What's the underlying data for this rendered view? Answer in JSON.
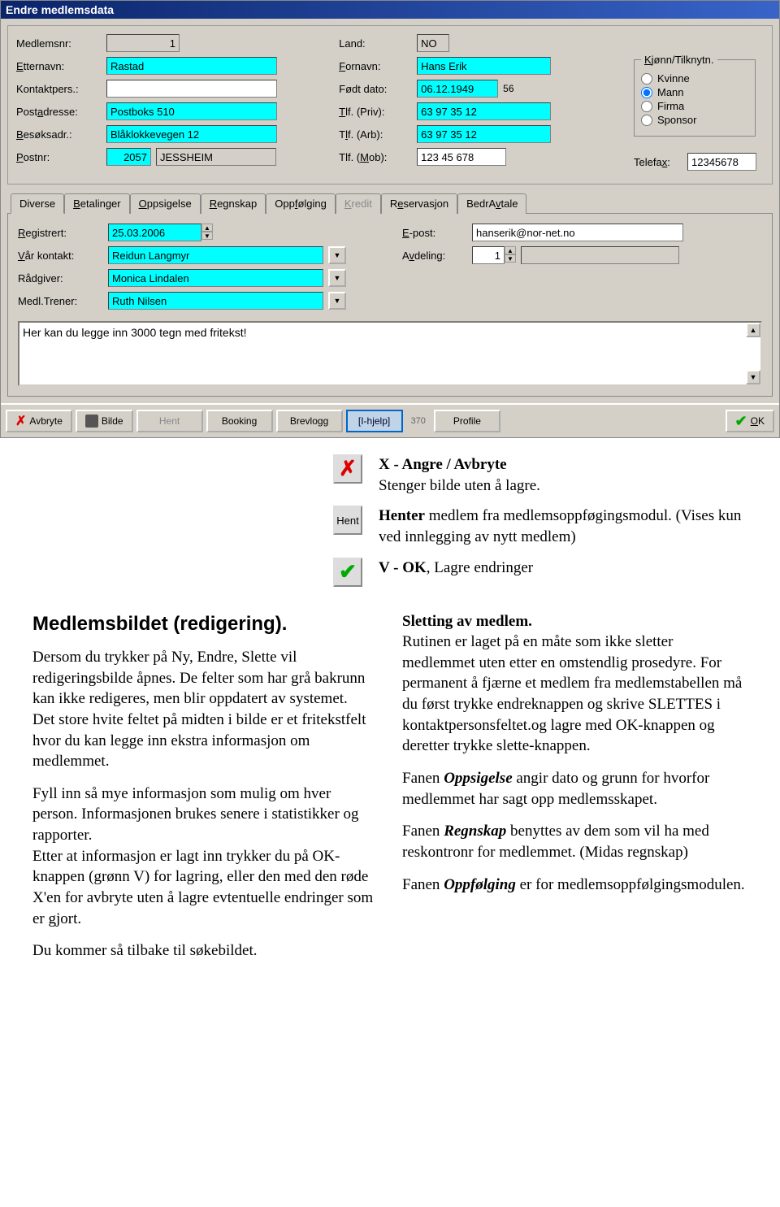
{
  "window": {
    "title": "Endre medlemsdata"
  },
  "labels": {
    "medlemsnr": "Medlemsnr:",
    "etternavn": "Etternavn:",
    "kontaktpers": "Kontaktpers.:",
    "postadresse": "Postadresse:",
    "besoksadr": "Besøksadr.:",
    "postnr": "Postnr:",
    "land": "Land:",
    "fornavn": "Fornavn:",
    "fodtdato": "Født dato:",
    "tlfpriv": "Tlf. (Priv):",
    "tlfarb": "Tlf. (Arb):",
    "tlfmob": "Tlf. (Mob):",
    "telefax": "Telefax:",
    "gender_legend": "Kjønn/Tilknytn.",
    "kvinne": "Kvinne",
    "mann": "Mann",
    "firma": "Firma",
    "sponsor": "Sponsor",
    "registrert": "Registrert:",
    "epost": "E-post:",
    "varkontakt": "Vår kontakt:",
    "avdeling": "Avdeling:",
    "radgiver": "Rådgiver:",
    "medltrener": "Medl.Trener:"
  },
  "values": {
    "medlemsnr": "1",
    "etternavn": "Rastad",
    "kontaktpers": "",
    "postadresse": "Postboks 510",
    "besoksadr": "Blåklokkevegen 12",
    "postnr": "2057",
    "poststed": "JESSHEIM",
    "land": "NO",
    "fornavn": "Hans Erik",
    "fodtdato": "06.12.1949",
    "alder": "56",
    "tlfpriv": "63 97 35 12",
    "tlfarb": "63 97 35 12",
    "tlfmob": "123 45 678",
    "telefax": "12345678",
    "registrert": "25.03.2006",
    "epost": "hanserik@nor-net.no",
    "varkontakt": "Reidun Langmyr",
    "avdeling": "1",
    "radgiver": "Monica Lindalen",
    "medltrener": "Ruth Nilsen",
    "freetext": "Her kan du legge inn 3000 tegn med fritekst!"
  },
  "tabs": {
    "diverse": "Diverse",
    "betalinger": "Betalinger",
    "oppsigelse": "Oppsigelse",
    "regnskap": "Regnskap",
    "oppfolging": "Oppfølging",
    "kredit": "Kredit",
    "reservasjon": "Reservasjon",
    "bedravtale": "BedrAvtale"
  },
  "buttons": {
    "avbryte": "Avbryte",
    "bilde": "Bilde",
    "hent": "Hent",
    "booking": "Booking",
    "brevlogg": "Brevlogg",
    "hjelp": "[I-hjelp]",
    "hjelp_num": "370",
    "profile": "Profile",
    "ok": "OK"
  },
  "doc": {
    "x_title": "X - Angre / Avbryte",
    "x_desc": "Stenger bilde uten å lagre.",
    "hent_label": "Hent",
    "hent_title": "Henter",
    "hent_desc1": " medlem fra medlemsoppføgingsmodul. (Vises kun ved innlegging av nytt medlem)",
    "ok_title": "V - OK",
    "ok_desc": ", Lagre endringer",
    "h1": "Medlemsbildet  (redigering).",
    "p1": " Dersom du trykker på Ny, Endre, Slette vil redigeringsbilde åpnes. De felter som har grå bakrunn kan ikke redigeres, men blir oppdatert av systemet.",
    "p1b": "Det store hvite feltet på midten i bilde er et fritekstfelt hvor du kan legge inn ekstra informasjon om medlemmet.",
    "p2": "Fyll inn så mye informasjon som mulig om hver person. Informasjonen brukes senere i statistikker og rapporter.",
    "p2b": "Etter at informasjon er lagt inn trykker du på OK-knappen (grønn V)  for lagring, eller den med den røde X'en for avbryte uten å lagre evtentuelle endringer som er gjort.",
    "p3": "Du kommer så tilbake til søkebildet.",
    "h2": "Sletting av medlem.",
    "p4": "Rutinen er laget på en måte som ikke sletter medlemmet uten etter en omstendlig prosedyre. For permanent å fjærne et medlem fra medlemstabellen må du først trykke endreknappen  og skrive SLETTES i kontaktpersonsfeltet.og lagre med OK-knappen og deretter trykke slette-knappen.",
    "p5a": "Fanen ",
    "p5b": "Oppsigelse",
    "p5c": " angir dato og grunn for hvorfor medlemmet har sagt opp medlemsskapet.",
    "p6a": "Fanen ",
    "p6b": "Regnskap",
    "p6c": " benyttes av dem som vil ha med reskontronr for medlemmet. (Midas regnskap)",
    "p7a": "Fanen ",
    "p7b": "Oppfølging",
    "p7c": " er for medlemsoppfølgingsmodulen."
  }
}
